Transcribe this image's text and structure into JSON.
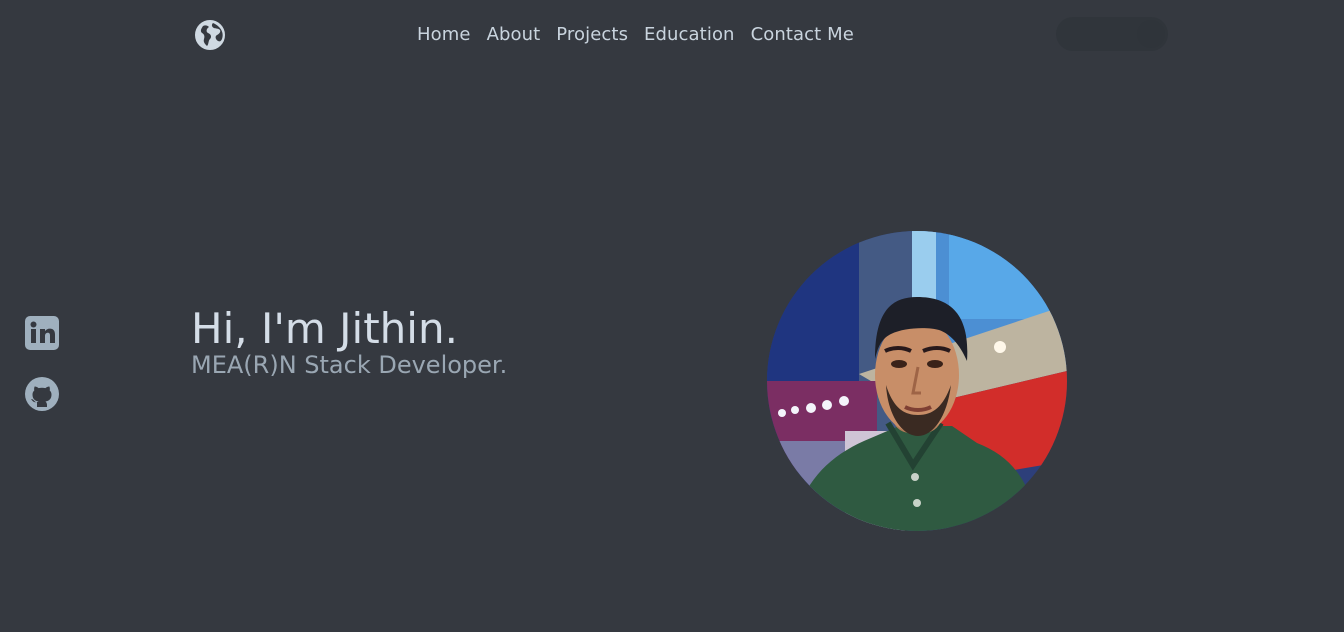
{
  "nav": {
    "logo_icon": "globe-icon",
    "links": [
      {
        "label": "Home"
      },
      {
        "label": "About"
      },
      {
        "label": "Projects"
      },
      {
        "label": "Education"
      },
      {
        "label": "Contact Me"
      }
    ]
  },
  "social": [
    {
      "icon": "linkedin-icon"
    },
    {
      "icon": "github-icon"
    }
  ],
  "hero": {
    "title": "Hi, I'm Jithin.",
    "subtitle": "MEA(R)N Stack Developer."
  },
  "colors": {
    "background": "#353940",
    "nav_text": "#c9d4de",
    "title_text": "#d4dde7",
    "subtitle_text": "#9aa7b3",
    "icon": "#9fb0be"
  }
}
